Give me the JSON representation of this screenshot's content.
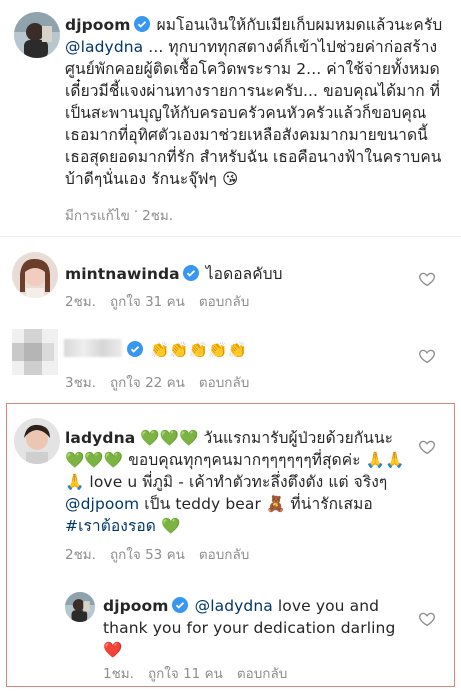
{
  "comments": [
    {
      "username": "djpoom",
      "text_parts": [
        "ผมโอนเงินให้กับเมียเก็บผมหมดแล้วนะครับ ",
        "@ladydna",
        " ... ทุกบาททุกสตางค์ก็เข้าไปช่วยค่าก่อสร้างศูนย์พักคอยผู้ติดเชื้อโควิดพระราม 2... ค่าใช้จ่ายทั้งหมดเดี๋ยวมีชี้แจงผ่านทางรายการนะครับ... ขอบคุณได้มาก ที่เป็นสะพานบุญให้กับครอบครัวคนหัวครัวแล้วก็ขอบคุณเธอมากที่อุทิศตัวเองมาช่วยเหลือสังคมมากมายขนาดนี้ เธอสุดยอดมากที่รัก สำหรับฉัน เธอคือนางฟ้าในคราบคนบ้าดีๆนั่นเอง รักนะจุ๊ฟๆ 😘"
      ],
      "meta": [
        "มีการแก้ไข",
        "·",
        "2ชม."
      ]
    },
    {
      "username": "mintnawinda",
      "text": "ไอดอลคับบ",
      "time": "2ชม.",
      "likes": "ถูกใจ 31 คน",
      "reply": "ตอบกลับ"
    },
    {
      "username": "",
      "text": "👏👏👏👏👏",
      "time": "3ชม.",
      "likes": "ถูกใจ 22 คน",
      "reply": "ตอบกลับ"
    },
    {
      "username": "ladydna",
      "text_a": "💚💚💚 วันแรกมารับผู้ป่วยด้วยกันนะ 💚💚💚 ขอบคุณทุกๆคนมากๆๆๆๆๆๆที่สุดค่ะ 🙏🙏🙏 love u พี่ภูมิ - เค้าทำตัวทะลึ่งตึงตัง แต่ จริงๆ ",
      "mention": "@djpoom",
      "text_b": " เป็น teddy bear 🧸 ที่น่ารักเสมอ ",
      "hashtag": "#เราต้องรอด",
      "text_c": " 💚",
      "time": "2ชม.",
      "likes": "ถูกใจ 53 คน",
      "reply": "ตอบกลับ"
    },
    {
      "username": "djpoom",
      "mention": "@ladydna",
      "text": " love you and thank you for your dedication darling ❤️",
      "time": "1ชม.",
      "likes": "ถูกใจ 11 คน",
      "reply": "ตอบกลับ"
    }
  ],
  "colors": {
    "mention": "#00376b",
    "meta": "#8e8e8e",
    "verified": "#3897f0",
    "highlight_border": "#d9867e"
  },
  "icons": [
    "verified-badge-icon",
    "heart-outline-icon"
  ]
}
